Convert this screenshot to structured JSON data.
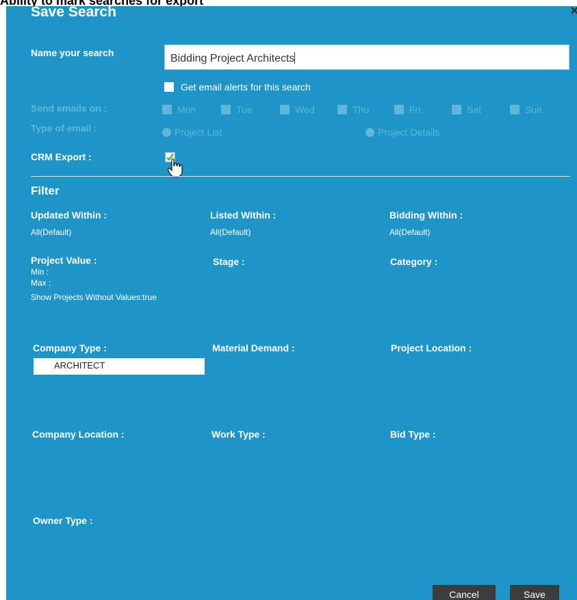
{
  "page": {
    "heading": "Ability to mark searches for export"
  },
  "dialog": {
    "title": "Save Search",
    "close_glyph": "×",
    "name_label": "Name your search",
    "name_value": "Bidding Project Architects",
    "email_alert_label": "Get email alerts for this search",
    "send_emails_label": "Send emails on :",
    "days": [
      "Mon",
      "Tue",
      "Wed",
      "Thu",
      "Fri",
      "Sat",
      "Sun"
    ],
    "email_type_label": "Type of email :",
    "email_types": [
      "Project List",
      "Project Details"
    ],
    "crm_label": "CRM Export :",
    "crm_checked": true
  },
  "filter": {
    "title": "Filter",
    "updated_within": {
      "label": "Updated Within :",
      "value": "All(Default)"
    },
    "listed_within": {
      "label": "Listed Within :",
      "value": "All(Default)"
    },
    "bidding_within": {
      "label": "Bidding Within :",
      "value": "All(Default)"
    },
    "project_value": {
      "label": "Project Value :",
      "min": "Min :",
      "max": "Max :",
      "without_values": "Show Projects Without Values:true"
    },
    "stage_label": "Stage :",
    "category_label": "Category :",
    "company_type": {
      "label": "Company Type :",
      "value": "ARCHITECT"
    },
    "material_demand_label": "Material Demand :",
    "project_location_label": "Project Location :",
    "company_location_label": "Company Location :",
    "work_type_label": "Work Type :",
    "bid_type_label": "Bid Type :",
    "owner_type_label": "Owner Type :"
  },
  "buttons": {
    "cancel": "Cancel",
    "save": "Save"
  },
  "colors": {
    "dialog_bg": "#1f94c6",
    "disabled_text": "#5fb8dc",
    "button_bg": "#3c3c3c"
  }
}
